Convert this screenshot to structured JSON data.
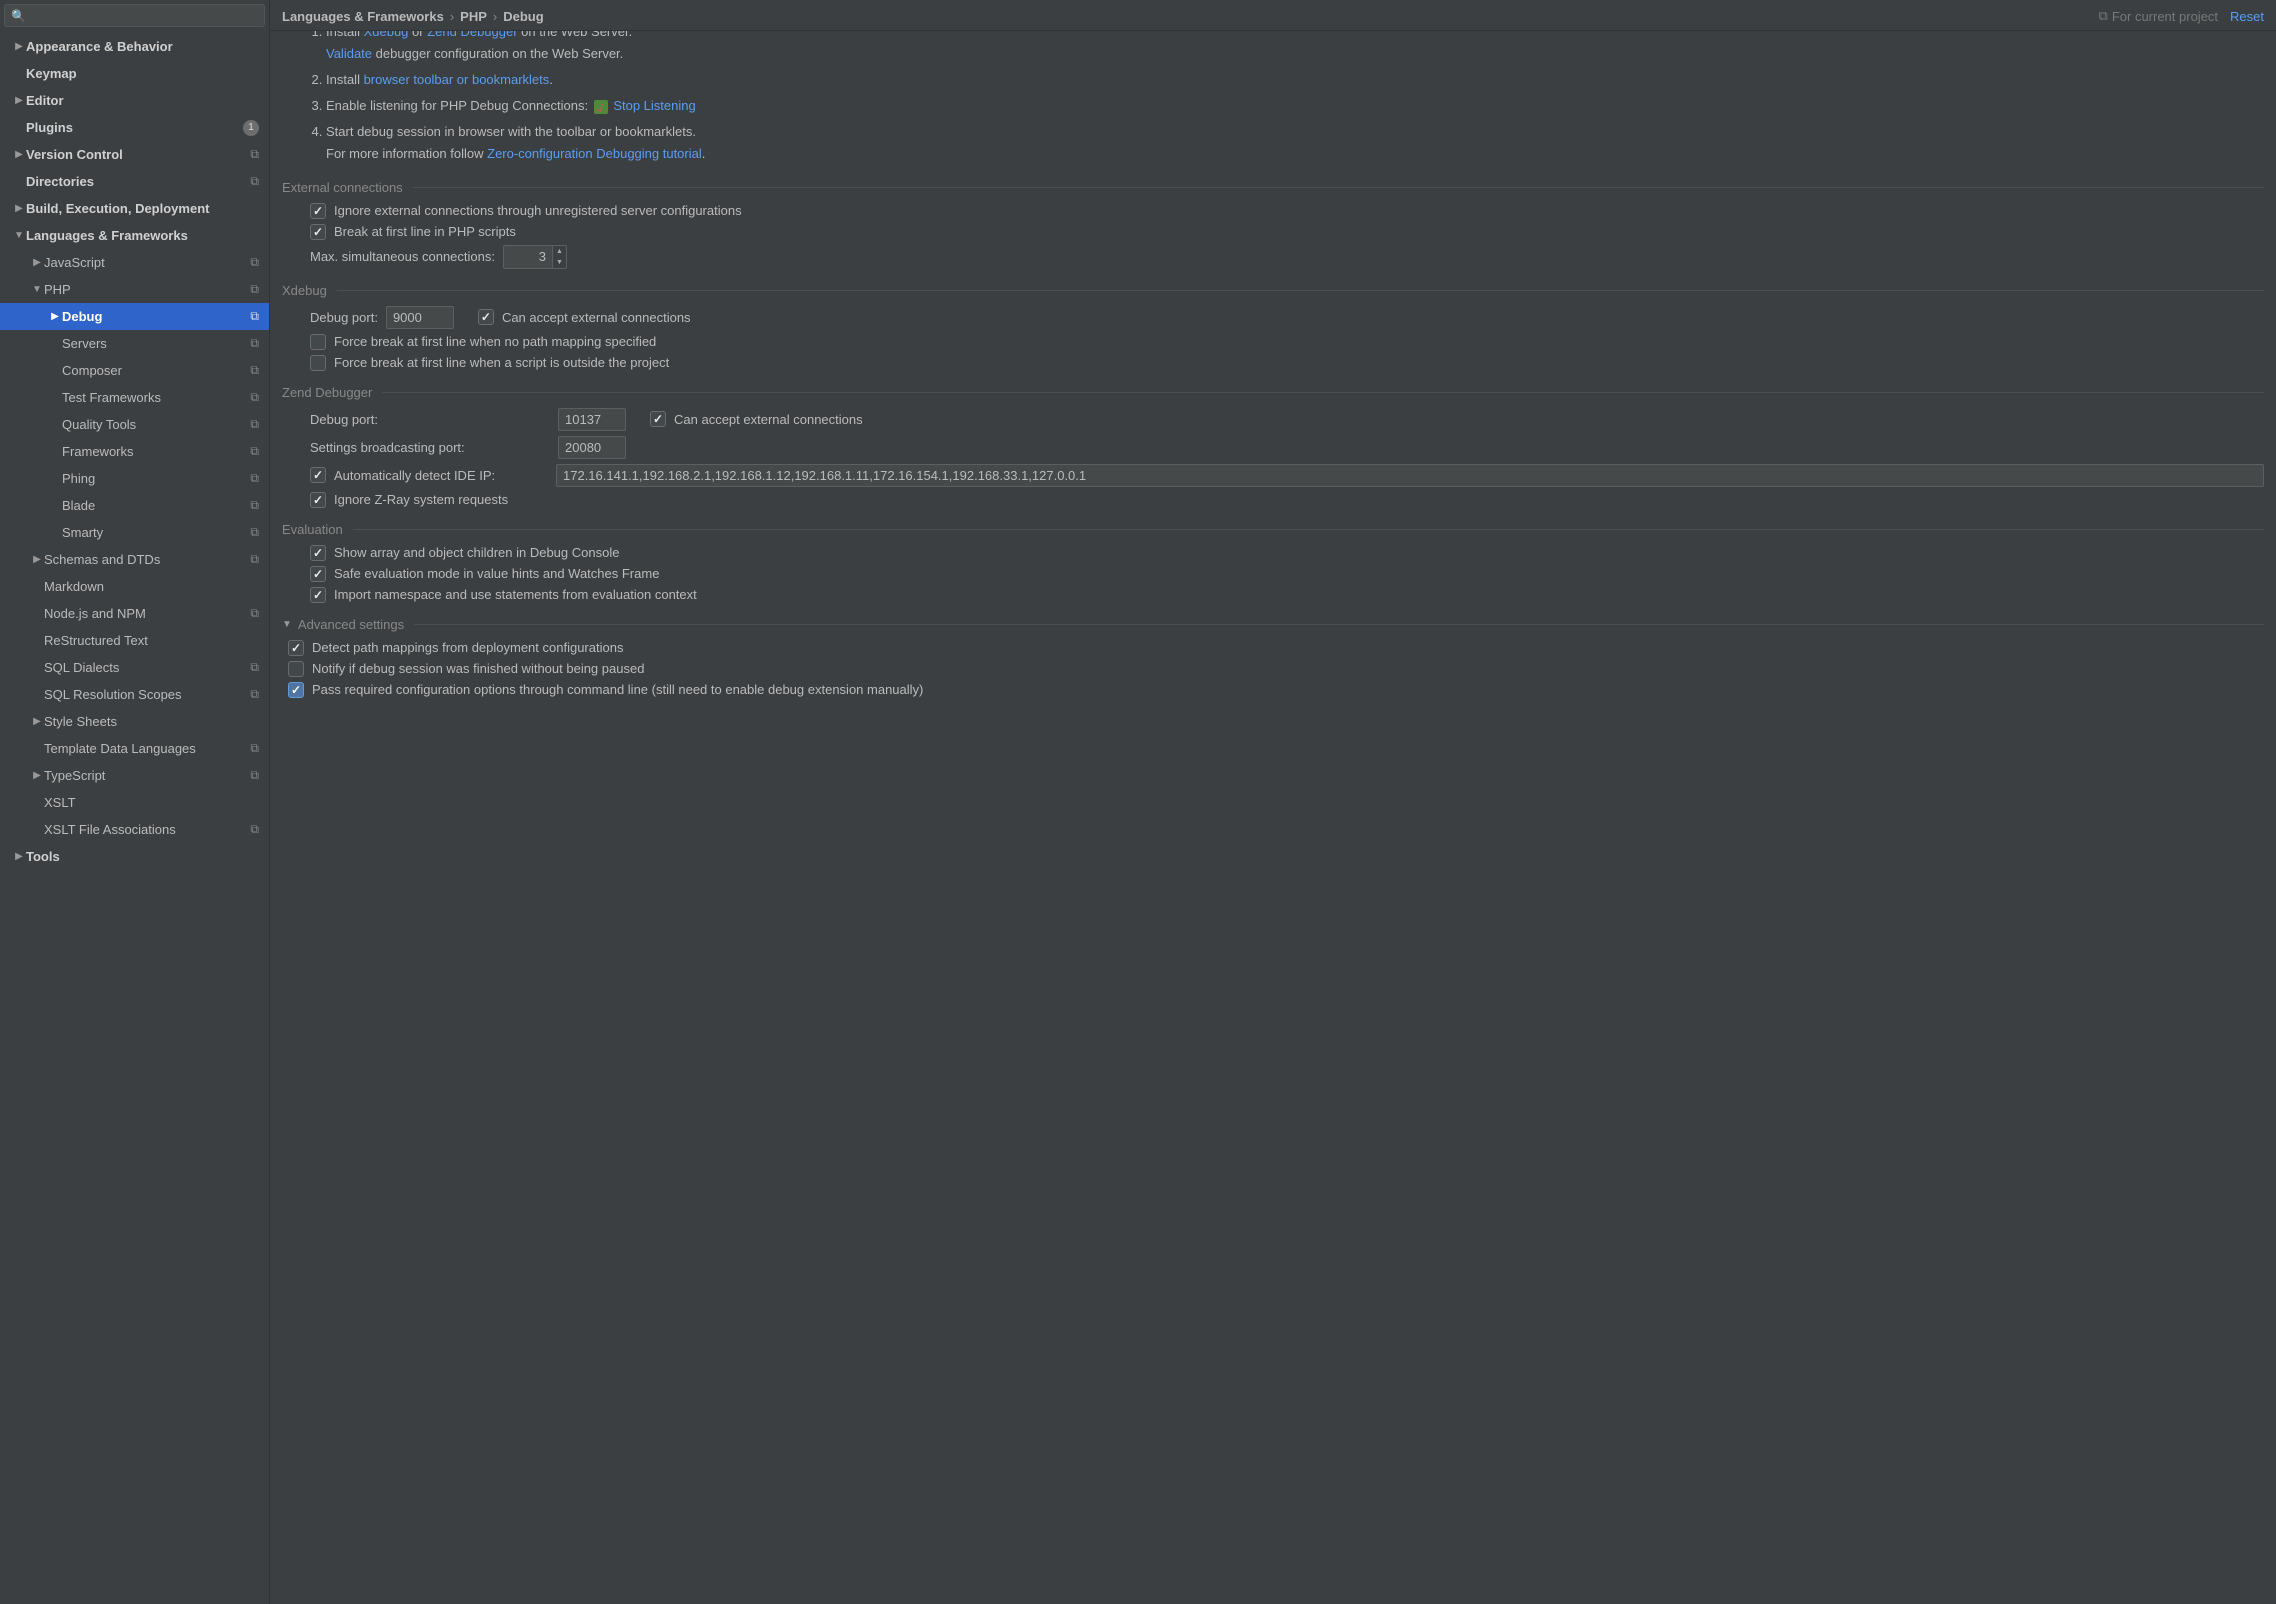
{
  "search": {
    "placeholder": ""
  },
  "breadcrumbs": [
    "Languages & Frameworks",
    "PHP",
    "Debug"
  ],
  "header": {
    "hint": "For current project",
    "reset": "Reset"
  },
  "sidebar": {
    "items": [
      {
        "label": "Appearance & Behavior",
        "indent": 0,
        "arrow": "▶",
        "bold": true
      },
      {
        "label": "Keymap",
        "indent": 0,
        "arrow": "",
        "bold": true
      },
      {
        "label": "Editor",
        "indent": 0,
        "arrow": "▶",
        "bold": true
      },
      {
        "label": "Plugins",
        "indent": 0,
        "arrow": "",
        "bold": true,
        "badge": "1"
      },
      {
        "label": "Version Control",
        "indent": 0,
        "arrow": "▶",
        "bold": true,
        "scope": true
      },
      {
        "label": "Directories",
        "indent": 0,
        "arrow": "",
        "bold": true,
        "scope": true
      },
      {
        "label": "Build, Execution, Deployment",
        "indent": 0,
        "arrow": "▶",
        "bold": true
      },
      {
        "label": "Languages & Frameworks",
        "indent": 0,
        "arrow": "▼",
        "bold": true
      },
      {
        "label": "JavaScript",
        "indent": 1,
        "arrow": "▶",
        "scope": true
      },
      {
        "label": "PHP",
        "indent": 1,
        "arrow": "▼",
        "scope": true
      },
      {
        "label": "Debug",
        "indent": 2,
        "arrow": "▶",
        "scope": true,
        "selected": true
      },
      {
        "label": "Servers",
        "indent": 2,
        "arrow": "",
        "scope": true
      },
      {
        "label": "Composer",
        "indent": 2,
        "arrow": "",
        "scope": true
      },
      {
        "label": "Test Frameworks",
        "indent": 2,
        "arrow": "",
        "scope": true
      },
      {
        "label": "Quality Tools",
        "indent": 2,
        "arrow": "",
        "scope": true
      },
      {
        "label": "Frameworks",
        "indent": 2,
        "arrow": "",
        "scope": true
      },
      {
        "label": "Phing",
        "indent": 2,
        "arrow": "",
        "scope": true
      },
      {
        "label": "Blade",
        "indent": 2,
        "arrow": "",
        "scope": true
      },
      {
        "label": "Smarty",
        "indent": 2,
        "arrow": "",
        "scope": true
      },
      {
        "label": "Schemas and DTDs",
        "indent": 1,
        "arrow": "▶",
        "scope": true
      },
      {
        "label": "Markdown",
        "indent": 1,
        "arrow": ""
      },
      {
        "label": "Node.js and NPM",
        "indent": 1,
        "arrow": "",
        "scope": true
      },
      {
        "label": "ReStructured Text",
        "indent": 1,
        "arrow": ""
      },
      {
        "label": "SQL Dialects",
        "indent": 1,
        "arrow": "",
        "scope": true
      },
      {
        "label": "SQL Resolution Scopes",
        "indent": 1,
        "arrow": "",
        "scope": true
      },
      {
        "label": "Style Sheets",
        "indent": 1,
        "arrow": "▶"
      },
      {
        "label": "Template Data Languages",
        "indent": 1,
        "arrow": "",
        "scope": true
      },
      {
        "label": "TypeScript",
        "indent": 1,
        "arrow": "▶",
        "scope": true
      },
      {
        "label": "XSLT",
        "indent": 1,
        "arrow": ""
      },
      {
        "label": "XSLT File Associations",
        "indent": 1,
        "arrow": "",
        "scope": true
      },
      {
        "label": "Tools",
        "indent": 0,
        "arrow": "▶",
        "bold": true
      }
    ]
  },
  "steps": {
    "s1a": "Install ",
    "s1_xdebug": "Xdebug",
    "s1b": " or ",
    "s1_zend": "Zend Debugger",
    "s1c": " on the Web Server.",
    "s1_validate": "Validate",
    "s1_validate_after": " debugger configuration on the Web Server.",
    "s2a": "Install ",
    "s2_link": "browser toolbar or bookmarklets",
    "s2b": ".",
    "s3a": "Enable listening for PHP Debug Connections: ",
    "s3_link": "Stop Listening",
    "s4a": "Start debug session in browser with the toolbar or bookmarklets.",
    "s4b": "For more information follow ",
    "s4_link": "Zero-configuration Debugging tutorial",
    "s4c": "."
  },
  "external": {
    "title": "External connections",
    "ignore": "Ignore external connections through unregistered server configurations",
    "break": "Break at first line in PHP scripts",
    "max_label": "Max. simultaneous connections:",
    "max_value": "3"
  },
  "xdebug": {
    "title": "Xdebug",
    "port_label": "Debug port:",
    "port": "9000",
    "accept": "Can accept external connections",
    "force1": "Force break at first line when no path mapping specified",
    "force2": "Force break at first line when a script is outside the project"
  },
  "zend": {
    "title": "Zend Debugger",
    "port_label": "Debug port:",
    "port": "10137",
    "accept": "Can accept external connections",
    "broadcast_label": "Settings broadcasting port:",
    "broadcast": "20080",
    "auto_ip": "Automatically detect IDE IP:",
    "ips": "172.16.141.1,192.168.2.1,192.168.1.12,192.168.1.11,172.16.154.1,192.168.33.1,127.0.0.1",
    "zray": "Ignore Z-Ray system requests"
  },
  "evaluation": {
    "title": "Evaluation",
    "e1": "Show array and object children in Debug Console",
    "e2": "Safe evaluation mode in value hints and Watches Frame",
    "e3": "Import namespace and use statements from evaluation context"
  },
  "advanced": {
    "title": "Advanced settings",
    "a1": "Detect path mappings from deployment configurations",
    "a2": "Notify if debug session was finished without being paused",
    "a3": "Pass required configuration options through command line (still need to enable debug extension manually)"
  }
}
